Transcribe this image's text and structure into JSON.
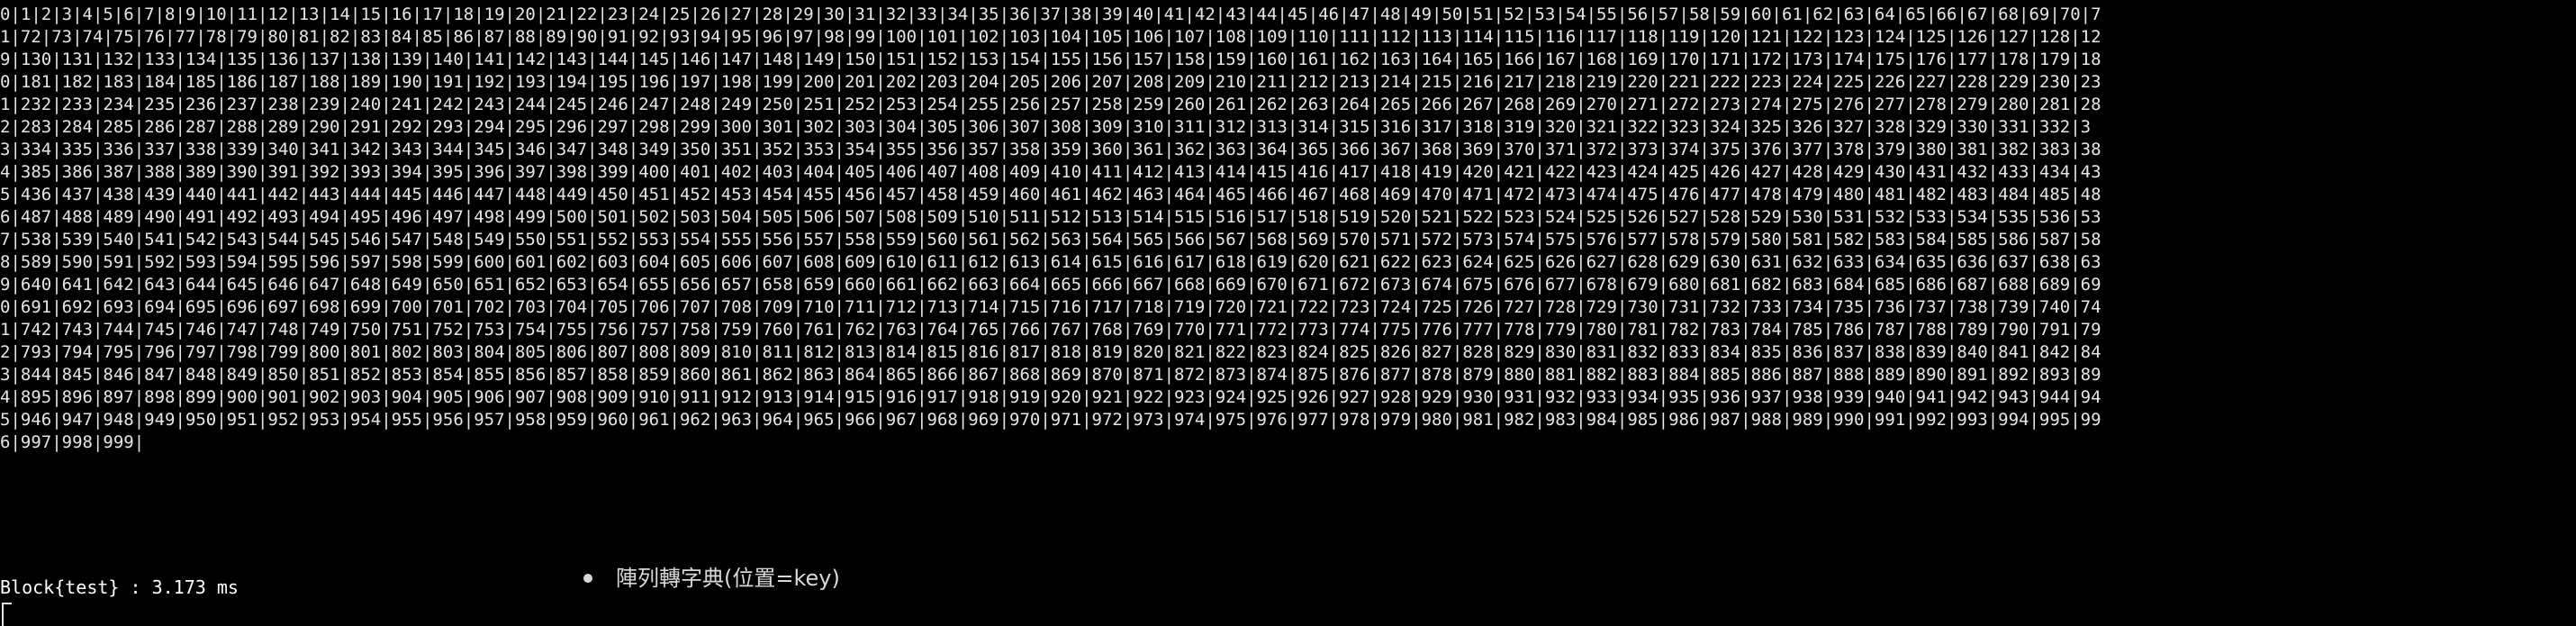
{
  "terminal": {
    "lines": [
      "0|1|2|3|4|5|6|7|8|9|10|11|12|13|14|15|16|17|18|19|20|21|22|23|24|25|26|27|28|29|30|31|32|33|34|35|36|37|38|39|40|41|42|43|44|45|46|47|48|49|50|51|52|53|54|55|56|57|58|59|60|61|62|63|64|65|66|67|68|69|70|7",
      "1|72|73|74|75|76|77|78|79|80|81|82|83|84|85|86|87|88|89|90|91|92|93|94|95|96|97|98|99|100|101|102|103|104|105|106|107|108|109|110|111|112|113|114|115|116|117|118|119|120|121|122|123|124|125|126|127|128|12",
      "9|130|131|132|133|134|135|136|137|138|139|140|141|142|143|144|145|146|147|148|149|150|151|152|153|154|155|156|157|158|159|160|161|162|163|164|165|166|167|168|169|170|171|172|173|174|175|176|177|178|179|18",
      "0|181|182|183|184|185|186|187|188|189|190|191|192|193|194|195|196|197|198|199|200|201|202|203|204|205|206|207|208|209|210|211|212|213|214|215|216|217|218|219|220|221|222|223|224|225|226|227|228|229|230|23",
      "1|232|233|234|235|236|237|238|239|240|241|242|243|244|245|246|247|248|249|250|251|252|253|254|255|256|257|258|259|260|261|262|263|264|265|266|267|268|269|270|271|272|273|274|275|276|277|278|279|280|281|28",
      "2|283|284|285|286|287|288|289|290|291|292|293|294|295|296|297|298|299|300|301|302|303|304|305|306|307|308|309|310|311|312|313|314|315|316|317|318|319|320|321|322|323|324|325|326|327|328|329|330|331|332|3",
      "3|334|335|336|337|338|339|340|341|342|343|344|345|346|347|348|349|350|351|352|353|354|355|356|357|358|359|360|361|362|363|364|365|366|367|368|369|370|371|372|373|374|375|376|377|378|379|380|381|382|383|38",
      "4|385|386|387|388|389|390|391|392|393|394|395|396|397|398|399|400|401|402|403|404|405|406|407|408|409|410|411|412|413|414|415|416|417|418|419|420|421|422|423|424|425|426|427|428|429|430|431|432|433|434|43",
      "5|436|437|438|439|440|441|442|443|444|445|446|447|448|449|450|451|452|453|454|455|456|457|458|459|460|461|462|463|464|465|466|467|468|469|470|471|472|473|474|475|476|477|478|479|480|481|482|483|484|485|48",
      "6|487|488|489|490|491|492|493|494|495|496|497|498|499|500|501|502|503|504|505|506|507|508|509|510|511|512|513|514|515|516|517|518|519|520|521|522|523|524|525|526|527|528|529|530|531|532|533|534|535|536|53",
      "7|538|539|540|541|542|543|544|545|546|547|548|549|550|551|552|553|554|555|556|557|558|559|560|561|562|563|564|565|566|567|568|569|570|571|572|573|574|575|576|577|578|579|580|581|582|583|584|585|586|587|58",
      "8|589|590|591|592|593|594|595|596|597|598|599|600|601|602|603|604|605|606|607|608|609|610|611|612|613|614|615|616|617|618|619|620|621|622|623|624|625|626|627|628|629|630|631|632|633|634|635|636|637|638|63",
      "9|640|641|642|643|644|645|646|647|648|649|650|651|652|653|654|655|656|657|658|659|660|661|662|663|664|665|666|667|668|669|670|671|672|673|674|675|676|677|678|679|680|681|682|683|684|685|686|687|688|689|69",
      "0|691|692|693|694|695|696|697|698|699|700|701|702|703|704|705|706|707|708|709|710|711|712|713|714|715|716|717|718|719|720|721|722|723|724|725|726|727|728|729|730|731|732|733|734|735|736|737|738|739|740|74",
      "1|742|743|744|745|746|747|748|749|750|751|752|753|754|755|756|757|758|759|760|761|762|763|764|765|766|767|768|769|770|771|772|773|774|775|776|777|778|779|780|781|782|783|784|785|786|787|788|789|790|791|79",
      "2|793|794|795|796|797|798|799|800|801|802|803|804|805|806|807|808|809|810|811|812|813|814|815|816|817|818|819|820|821|822|823|824|825|826|827|828|829|830|831|832|833|834|835|836|837|838|839|840|841|842|84",
      "3|844|845|846|847|848|849|850|851|852|853|854|855|856|857|858|859|860|861|862|863|864|865|866|867|868|869|870|871|872|873|874|875|876|877|878|879|880|881|882|883|884|885|886|887|888|889|890|891|892|893|89",
      "4|895|896|897|898|899|900|901|902|903|904|905|906|907|908|909|910|911|912|913|914|915|916|917|918|919|920|921|922|923|924|925|926|927|928|929|930|931|932|933|934|935|936|937|938|939|940|941|942|943|944|94",
      "5|946|947|948|949|950|951|952|953|954|955|956|957|958|959|960|961|962|963|964|965|966|967|968|969|970|971|972|973|974|975|976|977|978|979|980|981|982|983|984|985|986|987|988|989|990|991|992|993|994|995|99",
      "6|997|998|999|"
    ],
    "timing": "Block{test} : 3.173 ms"
  },
  "overlay": {
    "bullet_text": "陣列轉字典(位置=key)"
  },
  "colors": {
    "background": "#000000",
    "text": "#e6e6e6"
  }
}
